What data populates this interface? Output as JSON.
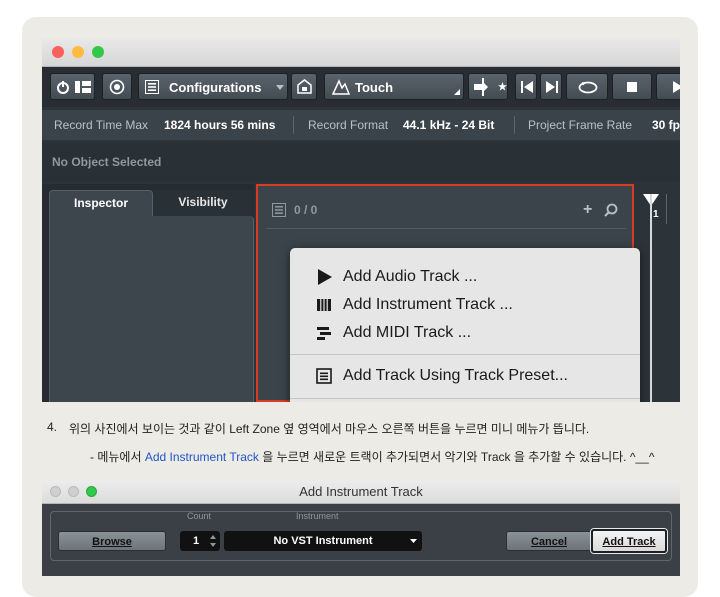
{
  "toolbar": {
    "configurations_label": "Configurations",
    "touch_label": "Touch"
  },
  "info_bar": {
    "record_time_max_label": "Record Time Max",
    "record_time_max_value": "1824 hours 56 mins",
    "record_format_label": "Record Format",
    "record_format_value": "44.1 kHz - 24 Bit",
    "project_frame_rate_label": "Project Frame Rate",
    "project_frame_rate_value": "30 fp"
  },
  "object_status": "No Object Selected",
  "left_zone": {
    "tabs": [
      "Inspector",
      "Visibility"
    ]
  },
  "track_list": {
    "count": "0 / 0",
    "add_symbol": "+"
  },
  "ruler_marker": "1",
  "context_menu": {
    "items": [
      {
        "label": "Add Audio Track ...",
        "icon": "play-triangle-icon"
      },
      {
        "label": "Add Instrument Track ...",
        "icon": "piano-keys-icon"
      },
      {
        "label": "Add MIDI Track ...",
        "icon": "midi-bars-icon"
      },
      {
        "label": "Add Track Using Track Preset...",
        "icon": "preset-list-icon"
      }
    ]
  },
  "instructions": {
    "step_number": "4.",
    "step_text": "위의 사진에서 보이는 것과 같이 Left Zone 옆 영역에서 마우스 오른쪽 버튼을 누르면 미니 메뉴가 뜹니다.",
    "sub_prefix": "- 메뉴에서 ",
    "sub_highlight": "Add Instrument Track",
    "sub_suffix": " 을 누르면 새로운 트랙이 추가되면서 악기와 Track 을 추가할 수 있습니다. ^__^"
  },
  "dialog": {
    "title": "Add Instrument Track",
    "count_label": "Count",
    "instrument_label": "Instrument",
    "browse_button": "Browse",
    "count_value": "1",
    "instrument_value": "No VST Instrument",
    "cancel_button": "Cancel",
    "add_track_button": "Add Track"
  },
  "colors": {
    "highlight_border": "#d93b25",
    "link_blue": "#1f56c6",
    "card_background": "#ecebe5"
  }
}
